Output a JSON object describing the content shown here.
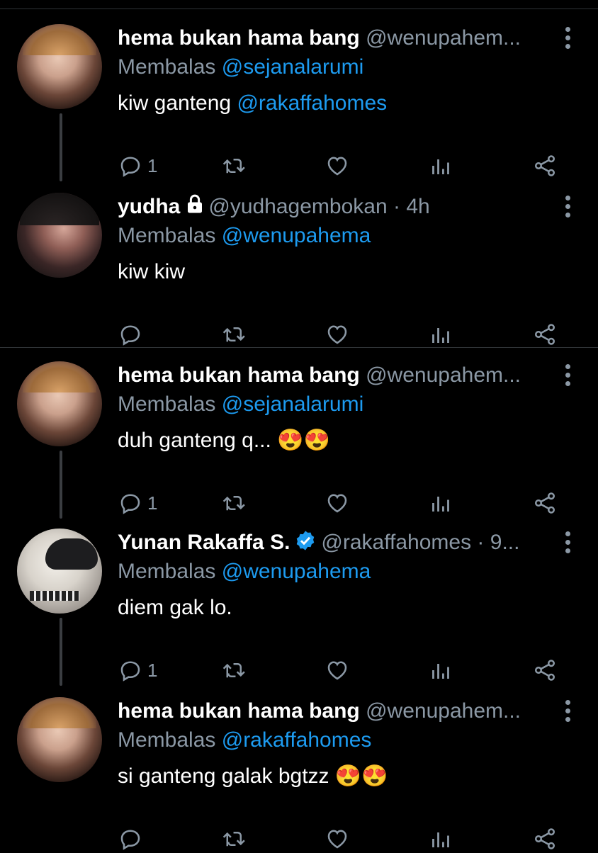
{
  "reply_label": "Membalas",
  "tweets": [
    {
      "name": "hema bukan hama bang",
      "handle": "@wenupahem...",
      "meta": "",
      "reply_to": "@sejanalarumi",
      "text": "kiw ganteng ",
      "text_mention": "@rakaffahomes",
      "reply_count": "1",
      "emoji": "",
      "badge": ""
    },
    {
      "name": "yudha",
      "handle": "@yudhagembokan",
      "meta": " · 4h",
      "reply_to": "@wenupahema",
      "text": "kiw kiw",
      "text_mention": "",
      "reply_count": "",
      "emoji": "",
      "badge": "lock-icon"
    },
    {
      "name": "hema bukan hama bang",
      "handle": "@wenupahem...",
      "meta": "",
      "reply_to": "@sejanalarumi",
      "text": "duh ganteng q... ",
      "text_mention": "",
      "reply_count": "1",
      "emoji": "😍😍",
      "badge": ""
    },
    {
      "name": "Yunan Rakaffa S.",
      "handle": "@rakaffahomes",
      "meta": " · 9...",
      "reply_to": "@wenupahema",
      "text": "diem gak lo.",
      "text_mention": "",
      "reply_count": "1",
      "emoji": "",
      "badge": "verified-icon"
    },
    {
      "name": "hema bukan hama bang",
      "handle": "@wenupahem...",
      "meta": "",
      "reply_to": "@rakaffahomes",
      "text": "si ganteng galak bgtzz ",
      "text_mention": "",
      "reply_count": "",
      "emoji": "😍😍",
      "badge": ""
    }
  ],
  "colors": {
    "background": "#000000",
    "secondary_text": "#8b98a5",
    "mention": "#1d9bf0",
    "verified": "#1d9bf0",
    "divider": "#2f3336"
  },
  "icons": [
    "reply-icon",
    "retweet-icon",
    "like-icon",
    "analytics-icon",
    "share-icon",
    "more-icon"
  ]
}
